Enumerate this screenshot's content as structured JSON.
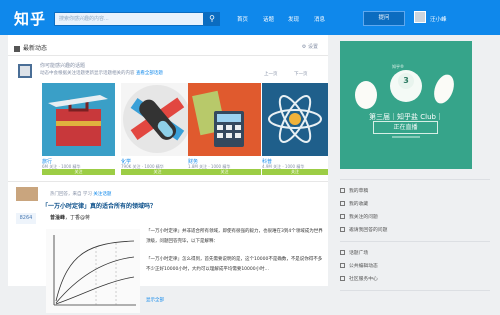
{
  "topbar": {
    "logo": "知乎",
    "search_placeholder": "搜索你感兴趣的内容...",
    "nav": [
      "首页",
      "话题",
      "发现",
      "消息"
    ],
    "ask_button": "提问",
    "username": "汪小峰"
  },
  "feed": {
    "header": "最新动态",
    "settings": "设置"
  },
  "recommend": {
    "title": "你可能感兴趣的话题",
    "subtitle": "动态中会根据关注话题更新显示话题相关的内容",
    "link": "查看全部话题",
    "prev": "上一页",
    "next": "下一页",
    "topics": [
      {
        "name": "旅行",
        "stat": "6M 关注 · 1000 精华",
        "button": "关注"
      },
      {
        "name": "化学",
        "stat": "790K 关注 · 1000 精华",
        "button": "关注"
      },
      {
        "name": "财务",
        "stat": "1.8M 关注 · 1000 精华",
        "button": "关注"
      },
      {
        "name": "科普",
        "stat": "4.9M 关注 · 1000 精华",
        "button": "关注"
      }
    ]
  },
  "answer": {
    "meta": "热门回答，来自 学习",
    "meta_action": "关注话题",
    "title": "「一万小时定律」真的适合所有的领域吗？",
    "votes": "8264",
    "author": "曾淦峰",
    "author_bio": "丁香@蒋",
    "paragraphs": [
      "「一万小时定律」并非适合所有领域，即使有很强的毅力，也很难在3到4个领域成为世界顶级，问题回答完毕，以下是解释：",
      "「一万小时定律」怎么得到，首先需要说明的是，这个10000不是确数，不是说你得不多不少正好10000小时，大约可以理解成平均需要10000小时..."
    ],
    "read_all": "显示全部"
  },
  "sidebar": {
    "club_reg": "知乎®",
    "club_number": "3",
    "club_title": "第三届｜知乎盐 Club｜",
    "club_live": "正在直播",
    "links_a": [
      "我的草稿",
      "我的收藏",
      "我关注的问题",
      "邀请我回答的问题"
    ],
    "links_b": [
      "话题广场",
      "公共编辑动态",
      "社区服务中心"
    ]
  },
  "colors": {
    "brand_blue": "#0f88eb",
    "follow_green": "#9ccd45",
    "club_green": "#36a48a"
  }
}
